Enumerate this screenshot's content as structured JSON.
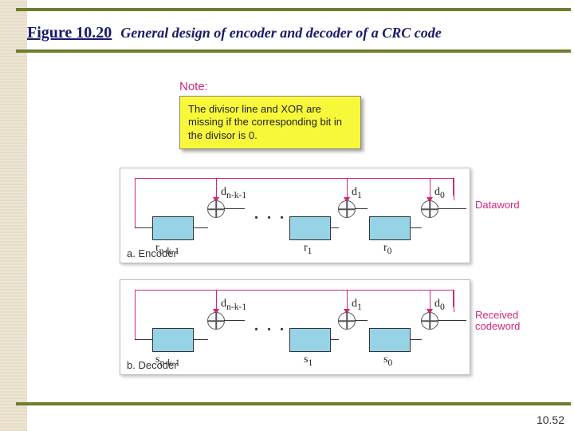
{
  "figure": {
    "number": "Figure 10.20",
    "caption": "General design of encoder and decoder of a CRC code"
  },
  "note": {
    "label": "Note:",
    "text": "The divisor line and XOR are missing if the corresponding bit in the divisor is 0."
  },
  "encoder": {
    "caption": "a. Encoder",
    "right_label": "Dataword",
    "d_left": "d",
    "d_left_sub": "n-k-1",
    "d1": "d",
    "d1_sub": "1",
    "d0": "d",
    "d0_sub": "0",
    "r_left": "r",
    "r_left_sub": "n-k-1",
    "r1": "r",
    "r1_sub": "1",
    "r0": "r",
    "r0_sub": "0",
    "dots": ". . ."
  },
  "decoder": {
    "caption": "b. Decoder",
    "right_label": "Received codeword",
    "d_left": "d",
    "d_left_sub": "n-k-1",
    "d1": "d",
    "d1_sub": "1",
    "d0": "d",
    "d0_sub": "0",
    "s_left": "s",
    "s_left_sub": "n-k-1",
    "s1": "s",
    "s1_sub": "1",
    "s0": "s",
    "s0_sub": "0",
    "dots": ". . ."
  },
  "page_number": "10.52"
}
